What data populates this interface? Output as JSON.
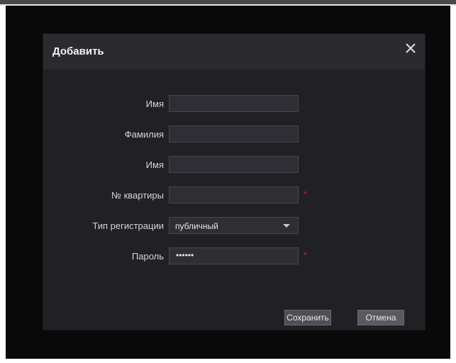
{
  "dialog": {
    "title": "Добавить",
    "close_icon": "close-icon"
  },
  "form": {
    "fields": [
      {
        "label": "Имя",
        "value": "",
        "required": false
      },
      {
        "label": "Фамилия",
        "value": "",
        "required": false
      },
      {
        "label": "Имя",
        "value": "",
        "required": false
      },
      {
        "label": "№ квартиры",
        "value": "",
        "required": true
      },
      {
        "label": "Тип регистрации",
        "value": "публичный",
        "type": "select"
      },
      {
        "label": "Пароль",
        "value": "••••••",
        "type": "password",
        "required": true
      }
    ],
    "required_mark": "*"
  },
  "buttons": {
    "save_label": "Сохранить",
    "cancel_label": "Отмена"
  },
  "colors": {
    "dialog_bg": "#212125",
    "header_bg": "#2b2b2f",
    "required": "#c0282d"
  }
}
